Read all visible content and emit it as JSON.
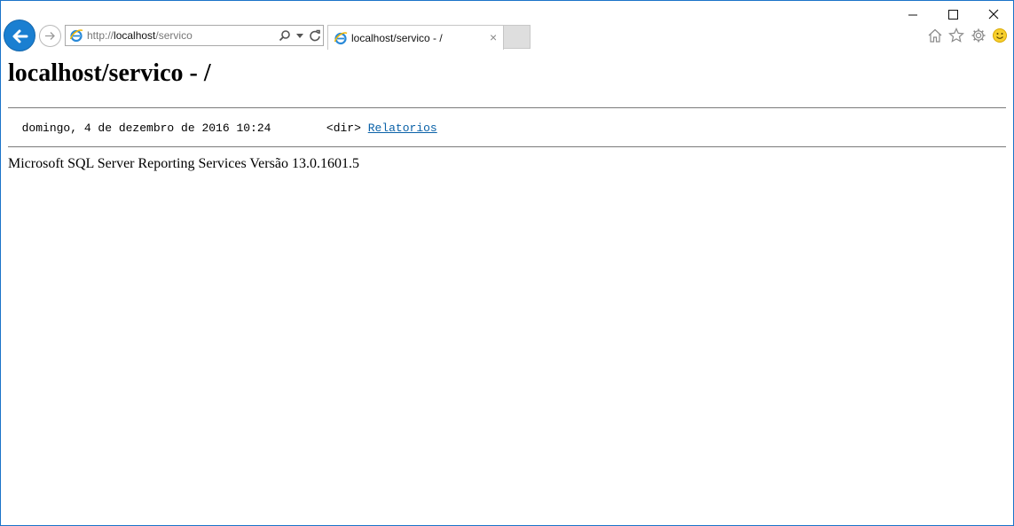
{
  "browser": {
    "address_scheme": "http://",
    "address_host": "localhost",
    "address_path": "/servico",
    "tab_title": "localhost/servico - /",
    "tab_close": "×",
    "accent": "#1a7fd1"
  },
  "page": {
    "heading": "localhost/servico - /",
    "entries": [
      {
        "date": "domingo, 4 de dezembro de 2016 10:24",
        "type": "<dir>",
        "name": "Relatorios"
      }
    ],
    "footer": "Microsoft SQL Server Reporting Services Versão 13.0.1601.5",
    "link_color": "#0b62a8"
  }
}
